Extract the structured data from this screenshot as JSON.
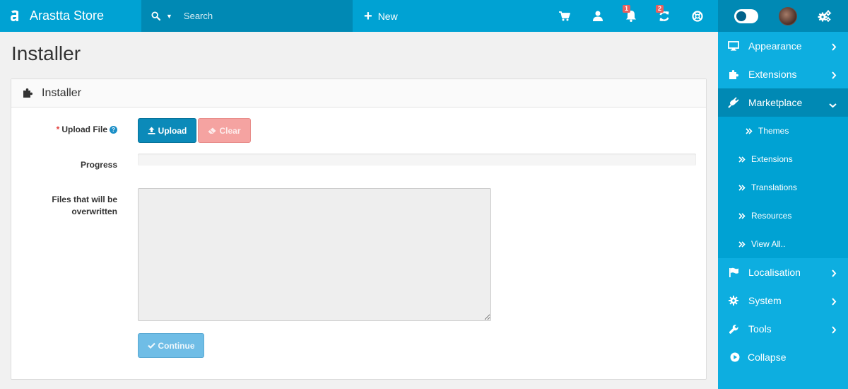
{
  "brand": {
    "name": "Arastta Store"
  },
  "search": {
    "placeholder": "Search"
  },
  "topbar": {
    "new_label": "New",
    "notifications_count": "1",
    "updates_count": "2"
  },
  "sidebar": {
    "items": [
      {
        "label": "Appearance",
        "icon": "monitor-icon"
      },
      {
        "label": "Extensions",
        "icon": "puzzle-icon"
      },
      {
        "label": "Marketplace",
        "icon": "plug-icon"
      },
      {
        "label": "Localisation",
        "icon": "flag-icon"
      },
      {
        "label": "System",
        "icon": "gear-icon"
      },
      {
        "label": "Tools",
        "icon": "wrench-icon"
      },
      {
        "label": "Collapse",
        "icon": "play-circle-icon"
      }
    ],
    "marketplace_sub": [
      {
        "label": "Themes"
      },
      {
        "label": "Extensions"
      },
      {
        "label": "Translations"
      },
      {
        "label": "Resources"
      },
      {
        "label": "View All.."
      }
    ]
  },
  "page": {
    "title": "Installer"
  },
  "panel": {
    "title": "Installer"
  },
  "form": {
    "upload_label": "Upload File",
    "required_mark": "*",
    "help_mark": "?",
    "upload_button": "Upload",
    "clear_button": "Clear",
    "progress_label": "Progress",
    "progress_value": 0,
    "files_label_line1": "Files that will be",
    "files_label_line2": "overwritten",
    "files_value": "",
    "continue_button": "Continue"
  },
  "colors": {
    "topbar": "#00a2d3",
    "topbar_dark": "#0089b4",
    "sidebar": "#0daee0",
    "upload_button": "#0b8ab9",
    "clear_button": "#f5a3a1",
    "continue_button": "#6fbde6",
    "badge": "#e8615f"
  }
}
